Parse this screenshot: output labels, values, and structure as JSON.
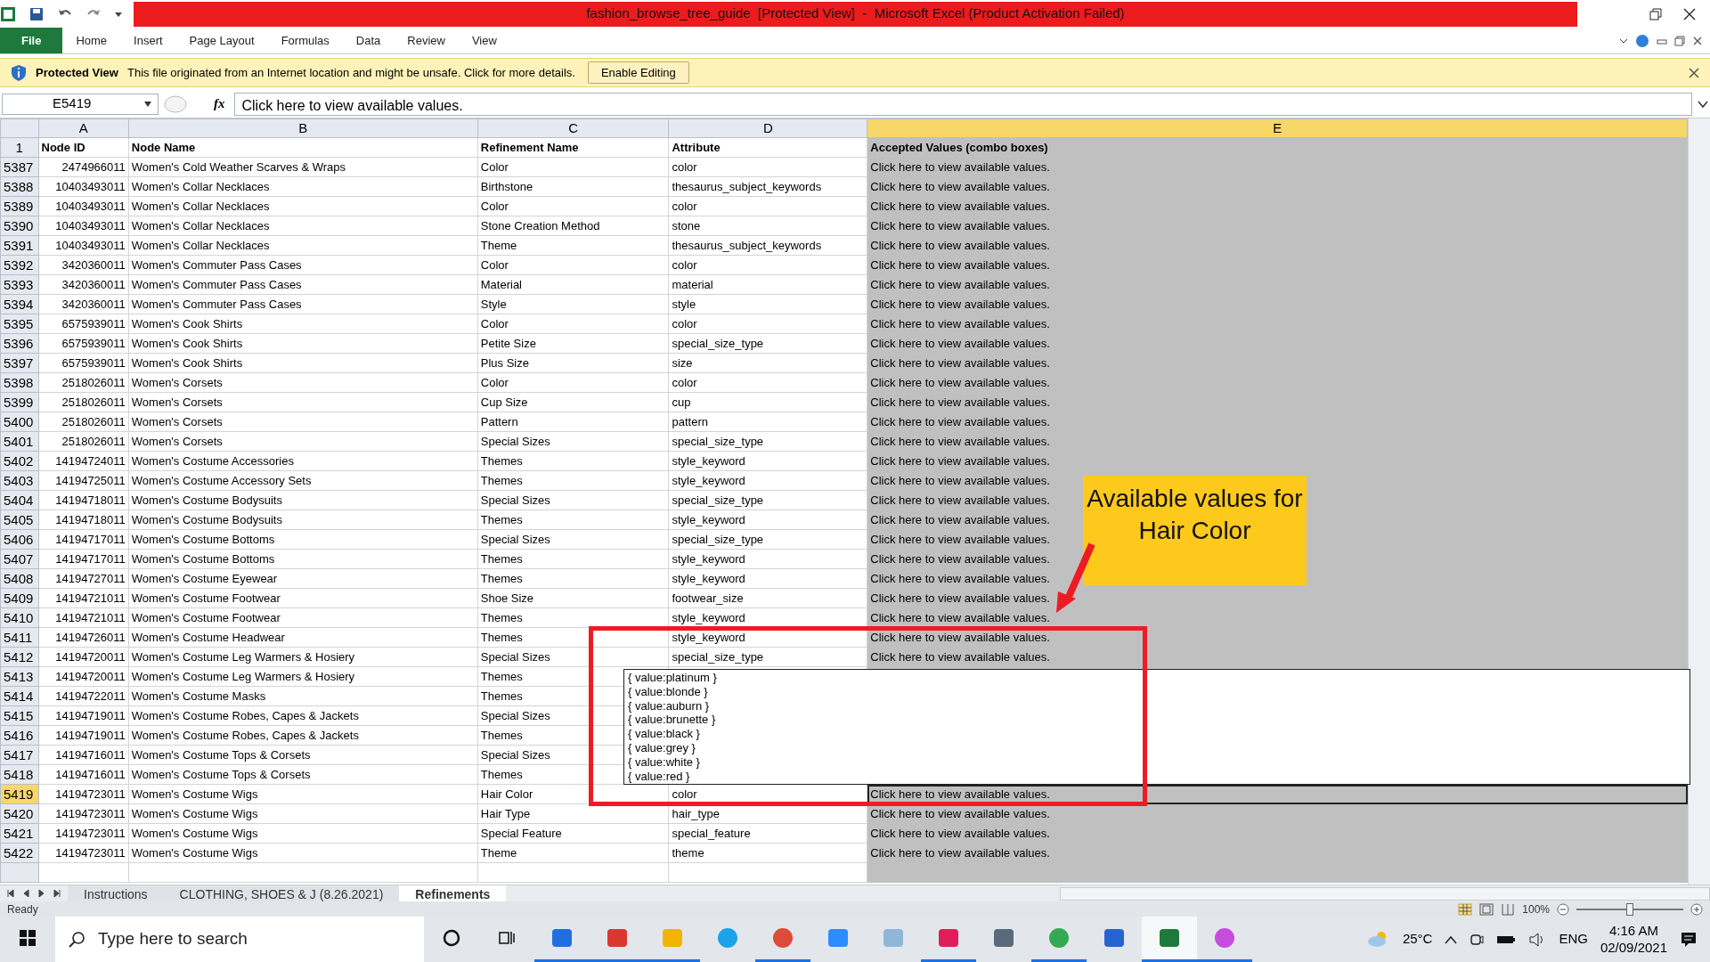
{
  "window": {
    "title": "fashion_browse_tree_guide  [Protected View]  -  Microsoft Excel (Product Activation Failed)"
  },
  "ribbon_tabs": [
    {
      "label": "File",
      "kind": "file"
    },
    {
      "label": "Home",
      "kind": "tab"
    },
    {
      "label": "Insert",
      "kind": "tab"
    },
    {
      "label": "Page Layout",
      "kind": "tab"
    },
    {
      "label": "Formulas",
      "kind": "tab"
    },
    {
      "label": "Data",
      "kind": "tab"
    },
    {
      "label": "Review",
      "kind": "tab"
    },
    {
      "label": "View",
      "kind": "tab"
    }
  ],
  "protected_view": {
    "title": "Protected View",
    "message": "This file originated from an Internet location and might be unsafe. Click for more details.",
    "button": "Enable Editing"
  },
  "formula_bar": {
    "name_box": "E5419",
    "function_label": "fx",
    "value": "Click here to view available values."
  },
  "columns": [
    {
      "letter": "A",
      "selected": false
    },
    {
      "letter": "B",
      "selected": false
    },
    {
      "letter": "C",
      "selected": false
    },
    {
      "letter": "D",
      "selected": false
    },
    {
      "letter": "E",
      "selected": true
    }
  ],
  "header_row": {
    "number": "1",
    "cells": [
      "Node ID",
      "Node Name",
      "Refinement Name",
      "Attribute",
      "Accepted Values (combo boxes)"
    ]
  },
  "rows": [
    {
      "number": "5387",
      "id": "2474966011",
      "node": "Women's Cold Weather Scarves & Wraps",
      "refinement": "Color",
      "attribute": "color",
      "accepted": "Click here to view available values.",
      "selected": false
    },
    {
      "number": "5388",
      "id": "10403493011",
      "node": "Women's Collar Necklaces",
      "refinement": "Birthstone",
      "attribute": "thesaurus_subject_keywords",
      "accepted": "Click here to view available values.",
      "selected": false
    },
    {
      "number": "5389",
      "id": "10403493011",
      "node": "Women's Collar Necklaces",
      "refinement": "Color",
      "attribute": "color",
      "accepted": "Click here to view available values.",
      "selected": false
    },
    {
      "number": "5390",
      "id": "10403493011",
      "node": "Women's Collar Necklaces",
      "refinement": "Stone Creation Method",
      "attribute": "stone",
      "accepted": "Click here to view available values.",
      "selected": false
    },
    {
      "number": "5391",
      "id": "10403493011",
      "node": "Women's Collar Necklaces",
      "refinement": "Theme",
      "attribute": "thesaurus_subject_keywords",
      "accepted": "Click here to view available values.",
      "selected": false
    },
    {
      "number": "5392",
      "id": "3420360011",
      "node": "Women's Commuter Pass Cases",
      "refinement": "Color",
      "attribute": "color",
      "accepted": "Click here to view available values.",
      "selected": false
    },
    {
      "number": "5393",
      "id": "3420360011",
      "node": "Women's Commuter Pass Cases",
      "refinement": "Material",
      "attribute": "material",
      "accepted": "Click here to view available values.",
      "selected": false
    },
    {
      "number": "5394",
      "id": "3420360011",
      "node": "Women's Commuter Pass Cases",
      "refinement": "Style",
      "attribute": "style",
      "accepted": "Click here to view available values.",
      "selected": false
    },
    {
      "number": "5395",
      "id": "6575939011",
      "node": "Women's Cook Shirts",
      "refinement": "Color",
      "attribute": "color",
      "accepted": "Click here to view available values.",
      "selected": false
    },
    {
      "number": "5396",
      "id": "6575939011",
      "node": "Women's Cook Shirts",
      "refinement": "Petite Size",
      "attribute": "special_size_type",
      "accepted": "Click here to view available values.",
      "selected": false
    },
    {
      "number": "5397",
      "id": "6575939011",
      "node": "Women's Cook Shirts",
      "refinement": "Plus Size",
      "attribute": "size",
      "accepted": "Click here to view available values.",
      "selected": false
    },
    {
      "number": "5398",
      "id": "2518026011",
      "node": "Women's Corsets",
      "refinement": "Color",
      "attribute": "color",
      "accepted": "Click here to view available values.",
      "selected": false
    },
    {
      "number": "5399",
      "id": "2518026011",
      "node": "Women's Corsets",
      "refinement": "Cup Size",
      "attribute": "cup",
      "accepted": "Click here to view available values.",
      "selected": false
    },
    {
      "number": "5400",
      "id": "2518026011",
      "node": "Women's Corsets",
      "refinement": "Pattern",
      "attribute": "pattern",
      "accepted": "Click here to view available values.",
      "selected": false
    },
    {
      "number": "5401",
      "id": "2518026011",
      "node": "Women's Corsets",
      "refinement": "Special Sizes",
      "attribute": "special_size_type",
      "accepted": "Click here to view available values.",
      "selected": false
    },
    {
      "number": "5402",
      "id": "14194724011",
      "node": "Women's Costume Accessories",
      "refinement": "Themes",
      "attribute": "style_keyword",
      "accepted": "Click here to view available values.",
      "selected": false
    },
    {
      "number": "5403",
      "id": "14194725011",
      "node": "Women's Costume Accessory Sets",
      "refinement": "Themes",
      "attribute": "style_keyword",
      "accepted": "Click here to view available values.",
      "selected": false
    },
    {
      "number": "5404",
      "id": "14194718011",
      "node": "Women's Costume Bodysuits",
      "refinement": "Special Sizes",
      "attribute": "special_size_type",
      "accepted": "Click here to view available values.",
      "selected": false
    },
    {
      "number": "5405",
      "id": "14194718011",
      "node": "Women's Costume Bodysuits",
      "refinement": "Themes",
      "attribute": "style_keyword",
      "accepted": "Click here to view available values.",
      "selected": false
    },
    {
      "number": "5406",
      "id": "14194717011",
      "node": "Women's Costume Bottoms",
      "refinement": "Special Sizes",
      "attribute": "special_size_type",
      "accepted": "Click here to view available values.",
      "selected": false
    },
    {
      "number": "5407",
      "id": "14194717011",
      "node": "Women's Costume Bottoms",
      "refinement": "Themes",
      "attribute": "style_keyword",
      "accepted": "Click here to view available values.",
      "selected": false
    },
    {
      "number": "5408",
      "id": "14194727011",
      "node": "Women's Costume Eyewear",
      "refinement": "Themes",
      "attribute": "style_keyword",
      "accepted": "Click here to view available values.",
      "selected": false
    },
    {
      "number": "5409",
      "id": "14194721011",
      "node": "Women's Costume Footwear",
      "refinement": "Shoe Size",
      "attribute": "footwear_size",
      "accepted": "Click here to view available values.",
      "selected": false
    },
    {
      "number": "5410",
      "id": "14194721011",
      "node": "Women's Costume Footwear",
      "refinement": "Themes",
      "attribute": "style_keyword",
      "accepted": "Click here to view available values.",
      "selected": false
    },
    {
      "number": "5411",
      "id": "14194726011",
      "node": "Women's Costume Headwear",
      "refinement": "Themes",
      "attribute": "style_keyword",
      "accepted": "Click here to view available values.",
      "selected": false
    },
    {
      "number": "5412",
      "id": "14194720011",
      "node": "Women's Costume Leg Warmers & Hosiery",
      "refinement": "Special Sizes",
      "attribute": "special_size_type",
      "accepted": "Click here to view available values.",
      "selected": false
    },
    {
      "number": "5413",
      "id": "14194720011",
      "node": "Women's Costume Leg Warmers & Hosiery",
      "refinement": "Themes",
      "selected": false
    },
    {
      "number": "5414",
      "id": "14194722011",
      "node": "Women's Costume Masks",
      "refinement": "Themes",
      "selected": false
    },
    {
      "number": "5415",
      "id": "14194719011",
      "node": "Women's Costume Robes, Capes & Jackets",
      "refinement": "Special Sizes",
      "selected": false
    },
    {
      "number": "5416",
      "id": "14194719011",
      "node": "Women's Costume Robes, Capes & Jackets",
      "refinement": "Themes",
      "selected": false
    },
    {
      "number": "5417",
      "id": "14194716011",
      "node": "Women's Costume Tops & Corsets",
      "refinement": "Special Sizes",
      "selected": false
    },
    {
      "number": "5418",
      "id": "14194716011",
      "node": "Women's Costume Tops & Corsets",
      "refinement": "Themes",
      "selected": false
    },
    {
      "number": "5419",
      "id": "14194723011",
      "node": "Women's Costume Wigs",
      "refinement": "Hair Color",
      "attribute": "color",
      "accepted": "Click here to view available values.",
      "selected": true
    },
    {
      "number": "5420",
      "id": "14194723011",
      "node": "Women's Costume Wigs",
      "refinement": "Hair Type",
      "attribute": "hair_type",
      "accepted": "Click here to view available values.",
      "selected": false
    },
    {
      "number": "5421",
      "id": "14194723011",
      "node": "Women's Costume Wigs",
      "refinement": "Special Feature",
      "attribute": "special_feature",
      "accepted": "Click here to view available values.",
      "selected": false
    },
    {
      "number": "5422",
      "id": "14194723011",
      "node": "Women's Costume Wigs",
      "refinement": "Theme",
      "attribute": "theme",
      "accepted": "Click here to view available values.",
      "selected": false
    }
  ],
  "dropdown": {
    "options": [
      "{ value:platinum }",
      "{ value:blonde }",
      "{ value:auburn }",
      "{ value:brunette }",
      "{ value:black }",
      "{ value:grey }",
      "{ value:white }",
      "{ value:red }"
    ]
  },
  "callout": {
    "text": "Available values for Hair Color"
  },
  "sheet_tabs": [
    {
      "label": "Instructions",
      "selected": false
    },
    {
      "label": "CLOTHING, SHOES & J (8.26.2021)",
      "selected": false
    },
    {
      "label": "Refinements",
      "selected": true
    }
  ],
  "status_bar": {
    "status": "Ready",
    "zoom": "100%",
    "level": 0.5
  },
  "taskbar": {
    "search_placeholder": "Type here to search",
    "temperature": "25°C",
    "language": "ENG",
    "time": "4:16 AM",
    "date": "02/09/2021"
  }
}
